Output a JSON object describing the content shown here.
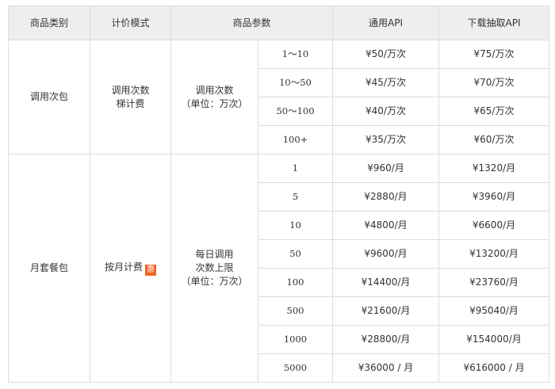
{
  "headers": [
    "商品类别",
    "计价模式",
    "商品参数",
    "通用API",
    "下载抽取API"
  ],
  "groups": [
    {
      "category": "调用次包",
      "mode_lines": [
        "调用次数",
        "梯计费"
      ],
      "badge": null,
      "param_lines": [
        "调用次数",
        "（单位：万次）"
      ],
      "rows": [
        {
          "tier": "1～10",
          "general": "¥50/万次",
          "download": "¥75/万次"
        },
        {
          "tier": "10～50",
          "general": "¥45/万次",
          "download": "¥70/万次"
        },
        {
          "tier": "50～100",
          "general": "¥40/万次",
          "download": "¥65/万次"
        },
        {
          "tier": "100+",
          "general": "¥35/万次",
          "download": "¥60/万次"
        }
      ]
    },
    {
      "category": "月套餐包",
      "mode_lines": [
        "按月计费"
      ],
      "badge": "惠",
      "param_lines": [
        "每日调用",
        "次数上限",
        "（单位：万次）"
      ],
      "rows": [
        {
          "tier": "1",
          "general": "¥960/月",
          "download": "¥1320/月"
        },
        {
          "tier": "5",
          "general": "¥2880/月",
          "download": "¥3960/月"
        },
        {
          "tier": "10",
          "general": "¥4800/月",
          "download": "¥6600/月"
        },
        {
          "tier": "50",
          "general": "¥9600/月",
          "download": "¥13200/月"
        },
        {
          "tier": "100",
          "general": "¥14400/月",
          "download": "¥23760/月"
        },
        {
          "tier": "500",
          "general": "¥21600/月",
          "download": "¥95040/月"
        },
        {
          "tier": "1000",
          "general": "¥28800/月",
          "download": "¥154000/月"
        },
        {
          "tier": "5000",
          "general": "¥36000 / 月",
          "download": "¥616000 / 月"
        }
      ]
    }
  ],
  "colors": {
    "header_bg": "#eeeeee",
    "border": "#dcdcdc",
    "text": "#333333",
    "badge": "#f26522"
  }
}
